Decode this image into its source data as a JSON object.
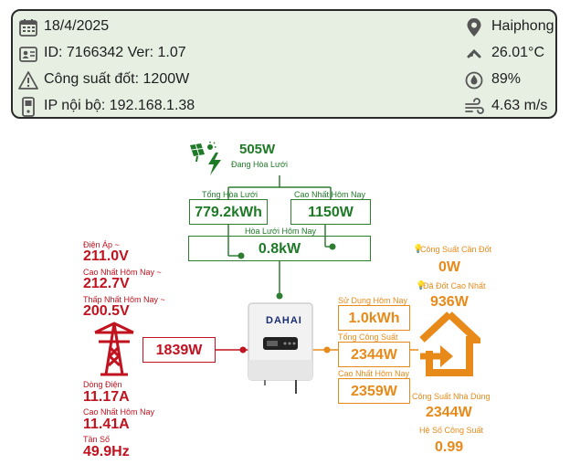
{
  "info": {
    "date": "18/4/2025",
    "id_ver": "ID: 7166342 Ver: 1.07",
    "power_label": "Công suất đốt: 1200W",
    "ip_label": "IP nội bộ: 192.168.1.38",
    "city": "Haiphong",
    "temperature": "26.01°C",
    "humidity": "89%",
    "wind": "4.63 m/s"
  },
  "solar": {
    "power": "505W",
    "status": "Đang Hòa Lưới"
  },
  "grid_tie": {
    "total_label": "Tổng Hòa Lưới",
    "total_value": "779.2kWh",
    "max_label": "Cao Nhất Hôm Nay",
    "max_value": "1150W",
    "today_label": "Hòa Lưới Hôm Nay",
    "today_value": "0.8kW"
  },
  "grid": {
    "voltage_label": "Điện Áp ~",
    "voltage": "211.0V",
    "max_today_label": "Cao Nhất Hôm Nay ~",
    "max_today": "212.7V",
    "min_today_label": "Thấp Nhất Hôm Nay ~",
    "min_today": "200.5V",
    "grid_power": "1839W",
    "current_label": "Dòng Điện",
    "current": "11.17A",
    "current_max_label": "Cao Nhất Hôm Nay",
    "current_max": "11.41A",
    "freq_label": "Tần Số",
    "freq": "49.9Hz"
  },
  "inverter": {
    "brand": "DAHAI"
  },
  "load": {
    "usage_label": "Sử Dụng Hôm Nay",
    "usage": "1.0kWh",
    "total_label": "Tổng Công Suất",
    "total": "2344W",
    "max_label": "Cao Nhất Hôm Nay",
    "max": "2359W",
    "burn_need_label": "Công Suất Cần Đốt",
    "burn_need": "0W",
    "burn_max_label": "Đã Đốt Cao Nhất",
    "burn_max": "936W",
    "home_label": "Công Suất Nhà Dùng",
    "home": "2344W",
    "pf_label": "Hệ Số Công Suất",
    "pf": "0.99"
  },
  "colors": {
    "green": "#1f7a27",
    "red": "#c1121f",
    "orange": "#e88a1a"
  },
  "icons": [
    "calendar-icon",
    "id-card-icon",
    "warning-icon",
    "device-icon",
    "location-pin-icon",
    "temperature-icon",
    "humidity-icon",
    "wind-icon",
    "solar-panel-icon",
    "transmission-tower-icon",
    "inverter-icon",
    "home-icon",
    "bulb-icon"
  ]
}
